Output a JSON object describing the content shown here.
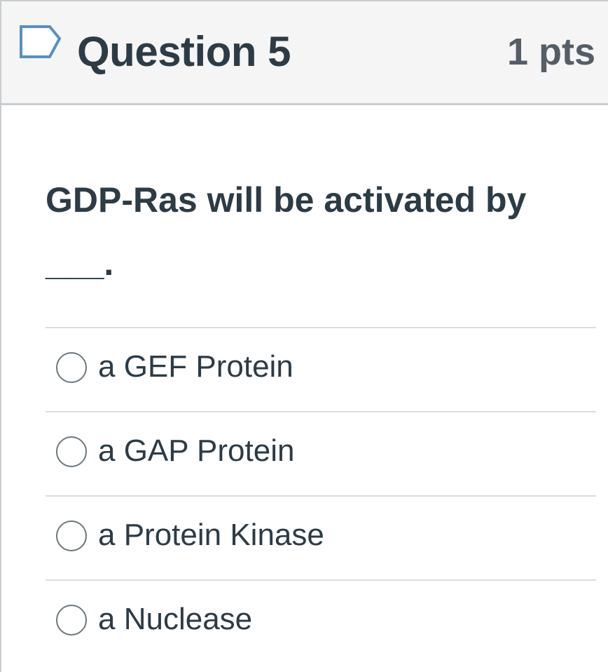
{
  "question": {
    "title": "Question 5",
    "points": "1 pts",
    "text_line1": "GDP-Ras will be activated by",
    "text_line2": "___.",
    "flag_icon": "flag-outline-icon"
  },
  "answers": [
    {
      "label": "a GEF Protein",
      "selected": false
    },
    {
      "label": "a GAP Protein",
      "selected": false
    },
    {
      "label": "a Protein Kinase",
      "selected": false
    },
    {
      "label": "a Nuclease",
      "selected": false
    }
  ],
  "colors": {
    "text": "#2d3b45",
    "points_text": "#555e66",
    "header_bg": "#f5f5f5",
    "border": "#c7cdd1",
    "divider": "#d8dde1",
    "radio_border": "#6b7780"
  }
}
